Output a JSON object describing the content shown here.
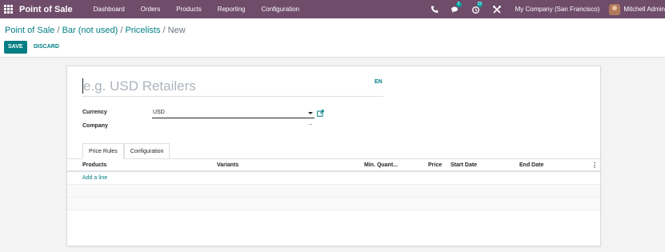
{
  "navbar": {
    "app_name": "Point of Sale",
    "menu": [
      "Dashboard",
      "Orders",
      "Products",
      "Reporting",
      "Configuration"
    ],
    "messages_count": "5",
    "activities_count": "22",
    "company": "My Company (San Francisco)",
    "user": "Mitchell Admin"
  },
  "breadcrumb": {
    "items": [
      "Point of Sale",
      "Bar (not used)",
      "Pricelists"
    ],
    "separator": "/",
    "current": "New"
  },
  "buttons": {
    "save": "SAVE",
    "discard": "DISCARD"
  },
  "form": {
    "name_placeholder": "e.g. USD Retailers",
    "lang": "EN",
    "currency_label": "Currency",
    "currency_value": "USD",
    "company_label": "Company",
    "company_value": ""
  },
  "tabs": [
    "Price Rules",
    "Configuration"
  ],
  "table": {
    "columns": [
      "Products",
      "Variants",
      "Min. Quant...",
      "Price",
      "Start Date",
      "End Date"
    ],
    "add_line": "Add a line"
  },
  "colors": {
    "navbar": "#6e4c6a",
    "primary": "#017e84",
    "badge": "#00a09d"
  },
  "icons": [
    "apps-icon",
    "phone-icon",
    "chat-icon",
    "activity-icon",
    "tools-icon",
    "external-link-icon",
    "chevron-down-icon",
    "optional-columns-icon"
  ]
}
